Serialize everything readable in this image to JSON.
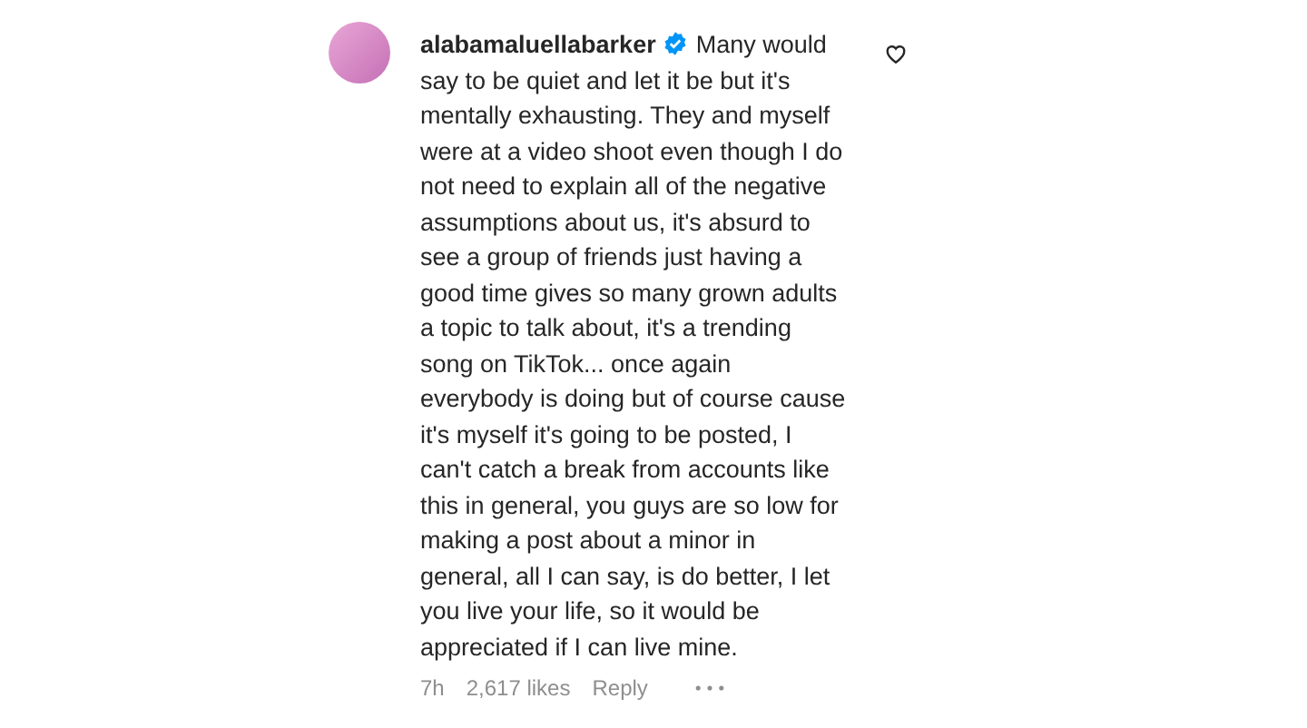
{
  "comment": {
    "username": "alabamaluellabarker",
    "verified": true,
    "text": "Many would say to be quiet and let it be but it's mentally exhausting. They and myself were at a video shoot even though I do not need to explain all of the negative assumptions about us, it's absurd to see a group of friends just having a good time gives so many grown adults a topic to talk about, it's a trending song on TikTok... once again everybody is doing but of course cause it's myself it's going to be posted, I can't catch a break from accounts like this in general, you guys are so low for making a post about a minor in general, all I can say, is do better, I let you live your life, so it would be appreciated if I can live mine.",
    "liked": false,
    "time": "7h",
    "likes": "2,617 likes",
    "reply": "Reply"
  }
}
